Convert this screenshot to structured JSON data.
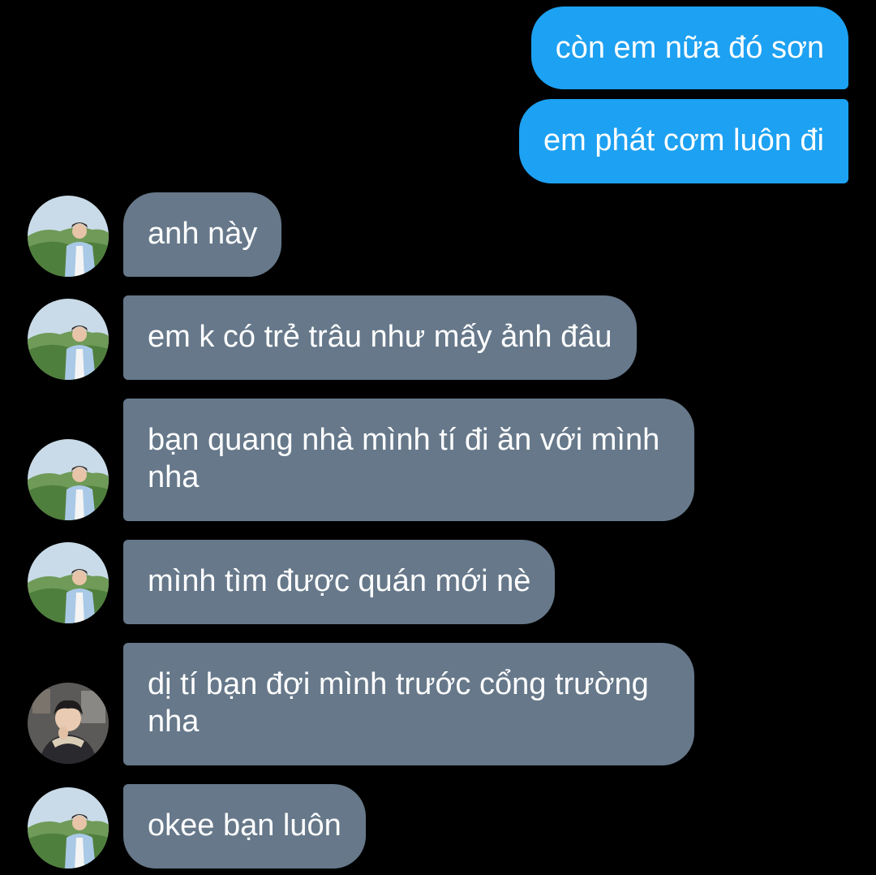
{
  "conversation": {
    "messages": [
      {
        "sender": "me",
        "text": "còn em nữa đó sơn"
      },
      {
        "sender": "me",
        "text": "em phát cơm luôn đi"
      },
      {
        "sender": "other",
        "avatar": "landscape-boy-avatar",
        "text": "anh này"
      },
      {
        "sender": "other",
        "avatar": "landscape-boy-avatar",
        "text": "em k có trẻ trâu như mấy ảnh đâu"
      },
      {
        "sender": "other",
        "avatar": "landscape-boy-avatar",
        "text": "bạn quang nhà mình tí đi ăn với mình nha"
      },
      {
        "sender": "other",
        "avatar": "landscape-boy-avatar",
        "text": "mình tìm được quán mới nè"
      },
      {
        "sender": "other",
        "avatar": "indoor-boy-avatar",
        "text": "dị tí bạn đợi mình trước cổng trường nha"
      },
      {
        "sender": "other",
        "avatar": "landscape-boy-avatar",
        "text": "okee bạn luôn"
      }
    ]
  },
  "colors": {
    "background": "#000000",
    "outgoing_bubble": "#1da1f2",
    "incoming_bubble": "#66788a",
    "text": "#ffffff"
  }
}
